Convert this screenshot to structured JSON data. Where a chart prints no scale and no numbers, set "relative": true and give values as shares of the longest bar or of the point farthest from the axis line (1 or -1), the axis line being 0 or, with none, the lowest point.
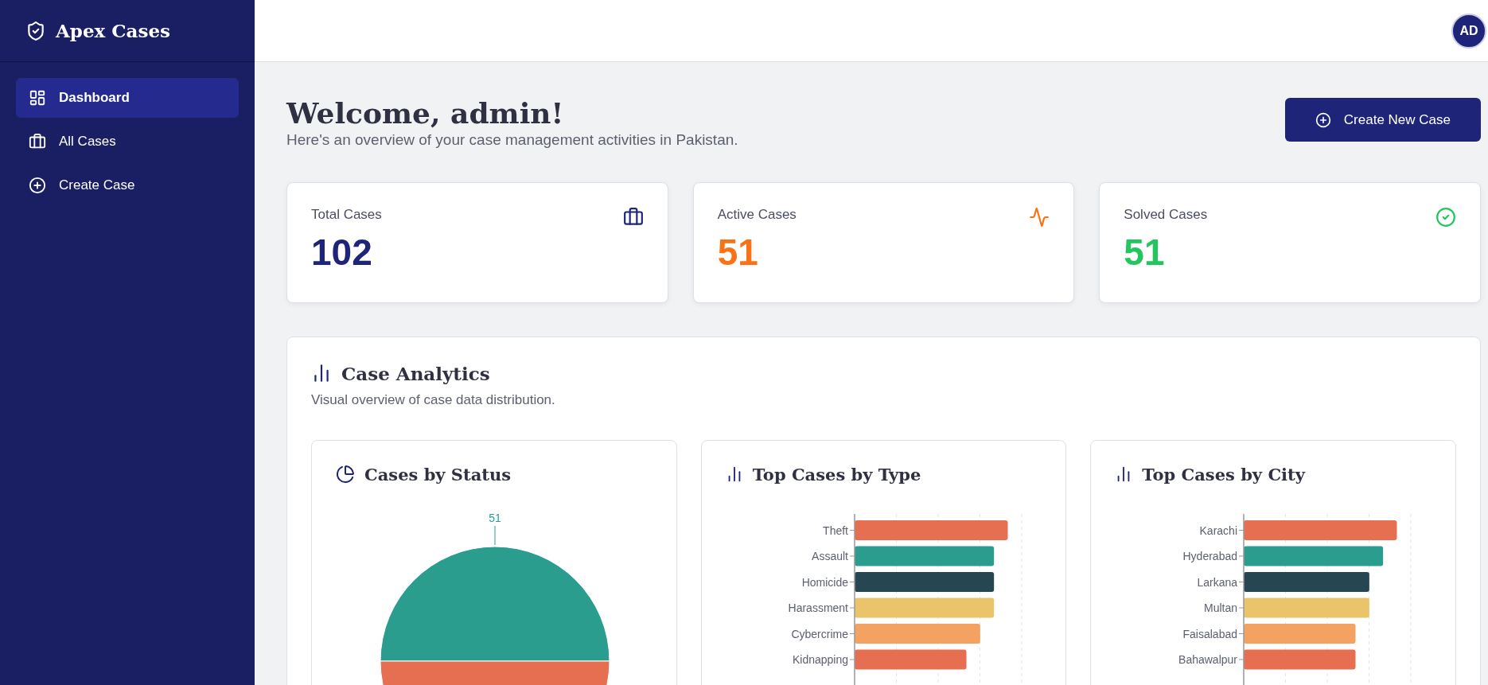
{
  "sidebar": {
    "brand": "Apex Cases",
    "items": [
      {
        "label": "Dashboard",
        "kind": "dashboard",
        "selected": true
      },
      {
        "label": "All Cases",
        "kind": "cases",
        "selected": false
      },
      {
        "label": "Create Case",
        "kind": "create",
        "selected": false
      }
    ]
  },
  "header": {
    "avatar": "AD"
  },
  "welcome": {
    "title": "Welcome, admin!",
    "subtitle": "Here's an overview of your case management activities in Pakistan.",
    "button": "Create New Case"
  },
  "stats": [
    {
      "label": "Total Cases",
      "value": "102",
      "kind": "total",
      "color": "#1e2478"
    },
    {
      "label": "Active Cases",
      "value": "51",
      "kind": "active",
      "color": "#f97316"
    },
    {
      "label": "Solved Cases",
      "value": "51",
      "kind": "solved",
      "color": "#22c55e"
    }
  ],
  "analytics": {
    "title": "Case Analytics",
    "subtitle": "Visual overview of case data distribution.",
    "charts": [
      {
        "title": "Cases by Status",
        "kind": "pie",
        "chart_data": {
          "type": "pie",
          "values": [
            51,
            51
          ],
          "value_labels": [
            "51",
            null
          ]
        }
      },
      {
        "title": "Top Cases by Type",
        "kind": "bar",
        "chart_data": {
          "type": "bar",
          "orientation": "horizontal",
          "categories": [
            "Theft",
            "Assault",
            "Homicide",
            "Harassment",
            "Cybercrime",
            "Kidnapping"
          ],
          "values": [
            1,
            0.91,
            0.91,
            0.91,
            0.82,
            0.73
          ],
          "relative": true
        }
      },
      {
        "title": "Top Cases by City",
        "kind": "bar",
        "chart_data": {
          "type": "bar",
          "orientation": "horizontal",
          "categories": [
            "Karachi",
            "Hyderabad",
            "Larkana",
            "Multan",
            "Faisalabad",
            "Bahawalpur"
          ],
          "values": [
            1,
            0.91,
            0.82,
            0.82,
            0.73,
            0.73
          ],
          "relative": true
        }
      }
    ]
  }
}
